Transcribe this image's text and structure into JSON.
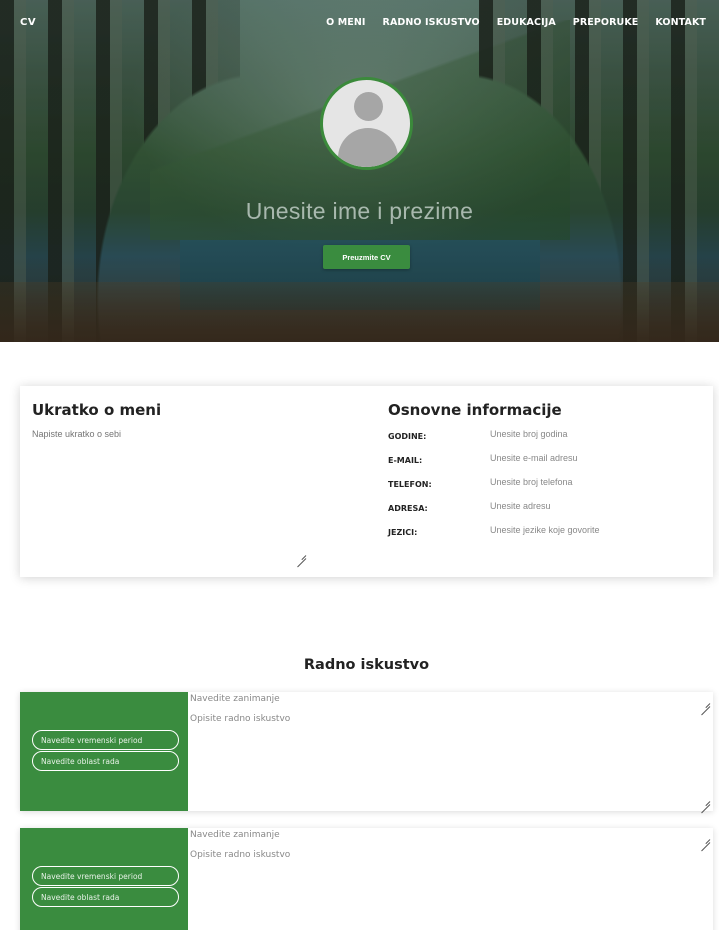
{
  "nav": {
    "brand": "CV",
    "items": [
      "O MENI",
      "RADNO ISKUSTVO",
      "EDUKACIJA",
      "PREPORUKE",
      "KONTAKT"
    ]
  },
  "hero": {
    "name_placeholder": "Unesite ime i prezime",
    "download_button": "Preuzmite CV"
  },
  "about": {
    "title": "Ukratko o meni",
    "placeholder": "Napiste ukratko o sebi"
  },
  "info": {
    "title": "Osnovne informacije",
    "rows": [
      {
        "label": "GODINE:",
        "placeholder": "Unesite broj godina"
      },
      {
        "label": "E-MAIL:",
        "placeholder": "Unesite e-mail adresu"
      },
      {
        "label": "TELEFON:",
        "placeholder": "Unesite broj telefona"
      },
      {
        "label": "ADRESA:",
        "placeholder": "Unesite adresu"
      },
      {
        "label": "JEZICI:",
        "placeholder": "Unesite jezike koje govorite"
      }
    ]
  },
  "work": {
    "title": "Radno iskustvo",
    "entries": [
      {
        "period": "Navedite vremenski period",
        "field": "Navedite oblast rada",
        "occupation": "Navedite zanimanje",
        "description": "Opisite radno iskustvo"
      },
      {
        "period": "Navedite vremenski period",
        "field": "Navedite oblast rada",
        "occupation": "Navedite zanimanje",
        "description": "Opisite radno iskustvo"
      }
    ]
  },
  "colors": {
    "accent": "#3a8c3f",
    "text_dark": "#222222",
    "placeholder": "#888888"
  }
}
